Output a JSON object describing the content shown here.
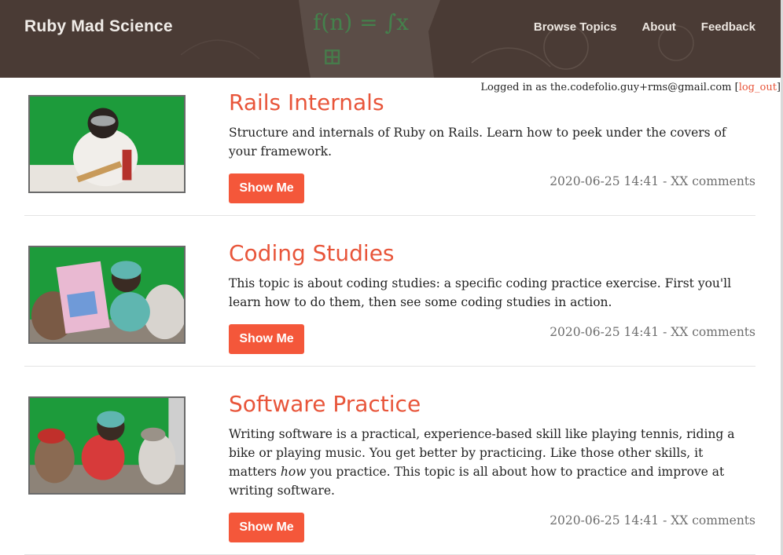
{
  "header": {
    "brand": "Ruby Mad Science",
    "nav": [
      "Browse Topics",
      "About",
      "Feedback"
    ]
  },
  "login": {
    "prefix": "Logged in as the.codefolio.guy+rms@gmail.com [",
    "logout_label": "log_out",
    "suffix": "]"
  },
  "topics": [
    {
      "title": "Rails Internals",
      "description": "Structure and internals of Ruby on Rails. Learn how to peek under the covers of your framework.",
      "button": "Show Me",
      "meta": "2020-06-25 14:41 - XX comments"
    },
    {
      "title": "Coding Studies",
      "description": "This topic is about coding studies: a specific coding practice exercise. First you'll learn how to do them, then see some coding studies in action.",
      "button": "Show Me",
      "meta": "2020-06-25 14:41 - XX comments"
    },
    {
      "title": "Software Practice",
      "description_before": "Writing software is a practical, experience-based skill like playing tennis, riding a bike or playing music. You get better by practicing. Like those other skills, it matters ",
      "description_em": "how",
      "description_after": " you practice. This topic is all about how to practice and improve at writing software.",
      "button": "Show Me",
      "meta": "2020-06-25 14:41 - XX comments"
    }
  ],
  "colors": {
    "accent": "#e8553a",
    "button": "#f4573a",
    "header_bg": "#4b3c36"
  }
}
